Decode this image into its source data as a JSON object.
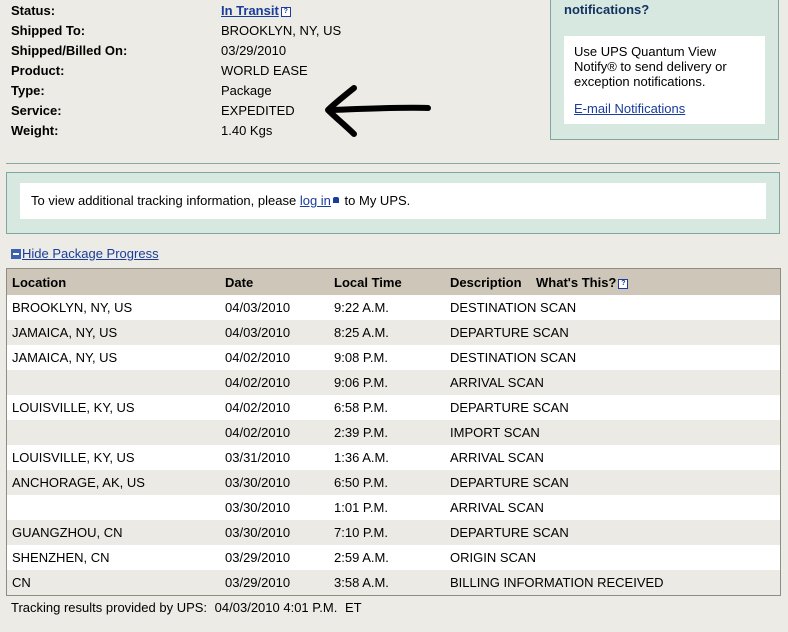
{
  "shipment": {
    "fields": [
      {
        "label": "Status:",
        "value": "In Transit",
        "link": true
      },
      {
        "label": "Shipped To:",
        "value": "BROOKLYN, NY, US"
      },
      {
        "label": "Shipped/Billed On:",
        "value": "03/29/2010"
      },
      {
        "label": "Product:",
        "value": "WORLD EASE"
      },
      {
        "label": "Type:",
        "value": "Package"
      },
      {
        "label": "Service:",
        "value": "EXPEDITED"
      },
      {
        "label": "Weight:",
        "value": "1.40 Kgs"
      }
    ],
    "help_glyph": "?"
  },
  "notify": {
    "title": "Need to send e-mail notifications?",
    "text": "Use UPS Quantum View Notify® to send delivery or exception notifications.",
    "link": "E-mail Notifications"
  },
  "login": {
    "text_before": "To view additional tracking information, please",
    "link": "log in",
    "text_after": "to My UPS."
  },
  "progress": {
    "toggle_label": "Hide Package Progress",
    "columns": [
      "Location",
      "Date",
      "Local Time",
      "Description",
      "What's This?"
    ],
    "rows": [
      [
        "BROOKLYN, NY, US",
        "04/03/2010",
        "9:22 A.M.",
        "DESTINATION SCAN"
      ],
      [
        "JAMAICA, NY, US",
        "04/03/2010",
        "8:25 A.M.",
        "DEPARTURE SCAN"
      ],
      [
        "JAMAICA, NY, US",
        "04/02/2010",
        "9:08 P.M.",
        "DESTINATION SCAN"
      ],
      [
        "",
        "04/02/2010",
        "9:06 P.M.",
        "ARRIVAL SCAN"
      ],
      [
        "LOUISVILLE, KY, US",
        "04/02/2010",
        "6:58 P.M.",
        "DEPARTURE SCAN"
      ],
      [
        "",
        "04/02/2010",
        "2:39 P.M.",
        "IMPORT SCAN"
      ],
      [
        "LOUISVILLE, KY, US",
        "03/31/2010",
        "1:36 A.M.",
        "ARRIVAL SCAN"
      ],
      [
        "ANCHORAGE, AK, US",
        "03/30/2010",
        "6:50 P.M.",
        "DEPARTURE SCAN"
      ],
      [
        "",
        "03/30/2010",
        "1:01 P.M.",
        "ARRIVAL SCAN"
      ],
      [
        "GUANGZHOU, CN",
        "03/30/2010",
        "7:10 P.M.",
        "DEPARTURE SCAN"
      ],
      [
        "SHENZHEN, CN",
        "03/29/2010",
        "2:59 A.M.",
        "ORIGIN SCAN"
      ],
      [
        "CN",
        "03/29/2010",
        "3:58 A.M.",
        "BILLING INFORMATION RECEIVED"
      ]
    ]
  },
  "footer": {
    "label": "Tracking results provided by UPS:",
    "date": "04/03/2010 4:01 P.M.",
    "tz": "ET"
  },
  "colors": {
    "link": "#1a3c9c",
    "panel": "#d7e8e0",
    "header": "#cdc6b9",
    "row_alt": "#ebeae5"
  }
}
